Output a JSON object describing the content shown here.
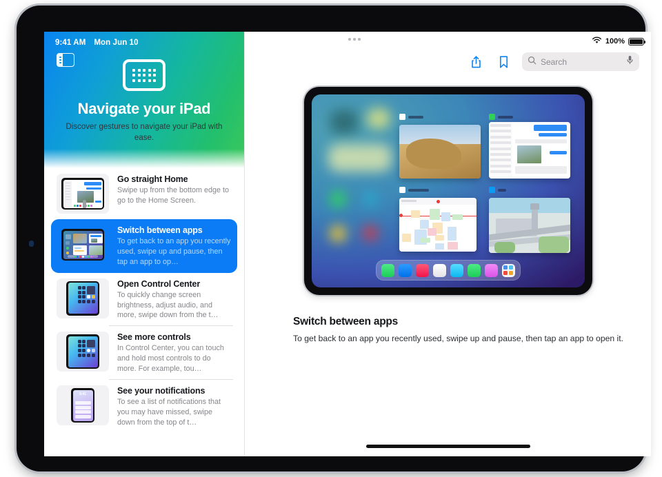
{
  "status_bar": {
    "time": "9:41 AM",
    "date": "Mon Jun 10",
    "battery_percent": "100%",
    "wifi_icon": "wifi-icon",
    "battery_icon": "battery-icon"
  },
  "sidebar": {
    "toggle_icon": "sidebar-toggle-icon",
    "hero": {
      "icon": "ipad-grid-icon",
      "title": "Navigate your iPad",
      "subtitle": "Discover gestures to navigate your iPad with ease."
    },
    "items": [
      {
        "title": "Go straight Home",
        "description": "Swipe up from the bottom edge to go to the Home Screen.",
        "thumbnail": "home-screen-gesture-thumbnail",
        "selected": false
      },
      {
        "title": "Switch between apps",
        "description": "To get back to an app you recently used, swipe up and pause, then tap an app to op…",
        "thumbnail": "app-switcher-thumbnail",
        "selected": true
      },
      {
        "title": "Open Control Center",
        "description": "To quickly change screen brightness, adjust audio, and more, swipe down from the t…",
        "thumbnail": "control-center-thumbnail",
        "selected": false
      },
      {
        "title": "See more controls",
        "description": "In Control Center, you can touch and hold most controls to do more. For example, tou…",
        "thumbnail": "control-center-more-thumbnail",
        "selected": false
      },
      {
        "title": "See your notifications",
        "description": "To see a list of notifications that you may have missed, swipe down from the top of t…",
        "thumbnail": "notifications-thumbnail",
        "selected": false
      }
    ]
  },
  "toolbar": {
    "multitask_icon": "multitasking-dots-icon",
    "share_icon": "share-icon",
    "bookmark_icon": "bookmark-icon",
    "search_icon": "search-icon",
    "search_placeholder": "Search",
    "search_value": "",
    "mic_icon": "microphone-icon"
  },
  "illustration": {
    "name": "ipad-app-switcher-illustration",
    "cards": [
      {
        "name": "photos-app-card",
        "accent": "#ffffff"
      },
      {
        "name": "mail-app-card",
        "accent": "#31d158"
      },
      {
        "name": "calendar-app-card",
        "accent": "#ffffff"
      },
      {
        "name": "maps-app-card",
        "accent": "#0a9cf5"
      }
    ],
    "dock_apps": [
      "#2fe06a",
      "#0a84f5",
      "#fb3b5c",
      "#f2f2f4",
      "#2ec8f5",
      "#2fe06a",
      "#e36cf0"
    ],
    "app_library_icon": "app-library-icon"
  },
  "main": {
    "heading": "Switch between apps",
    "body": "To get back to an app you recently used, swipe up and pause, then tap an app to open it."
  },
  "colors": {
    "accent_blue": "#0b7cf5",
    "gradient_start": "#0a84f0",
    "gradient_end": "#3cc85a",
    "muted_text": "#86868b"
  },
  "home_indicator": "home-indicator"
}
